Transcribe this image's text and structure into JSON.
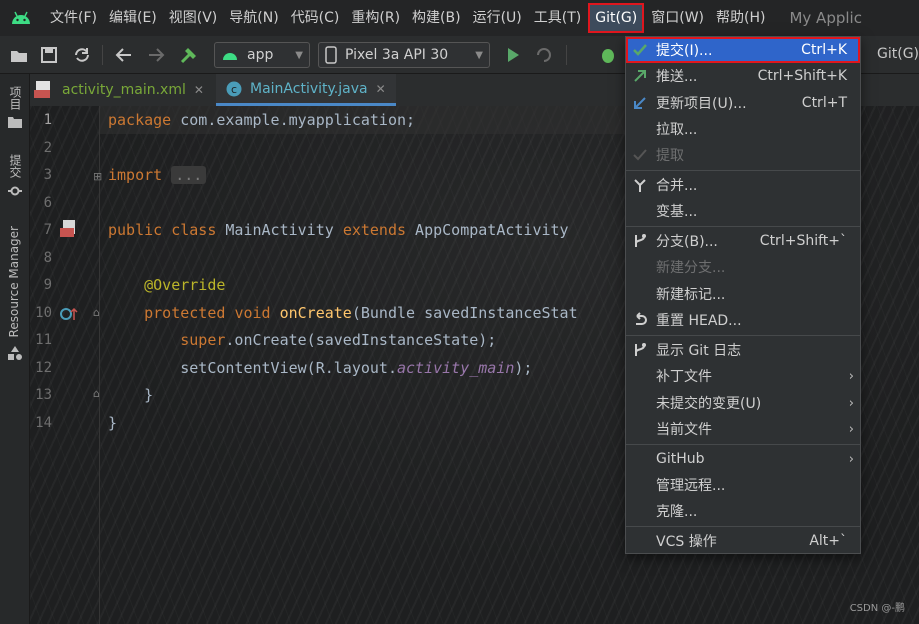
{
  "menubar": {
    "items": [
      {
        "label": "文件(F)"
      },
      {
        "label": "编辑(E)"
      },
      {
        "label": "视图(V)"
      },
      {
        "label": "导航(N)"
      },
      {
        "label": "代码(C)"
      },
      {
        "label": "重构(R)"
      },
      {
        "label": "构建(B)"
      },
      {
        "label": "运行(U)"
      },
      {
        "label": "工具(T)"
      },
      {
        "label": "Git(G)"
      },
      {
        "label": "窗口(W)"
      },
      {
        "label": "帮助(H)"
      }
    ],
    "window_title": "My Applic"
  },
  "toolbar": {
    "module": "app",
    "device": "Pixel 3a API 30",
    "git_label": "Git(G)"
  },
  "left_strip": {
    "project": "项目",
    "commit": "提交",
    "resource_manager": "Resource Manager"
  },
  "tabs": [
    {
      "label": "activity_main.xml"
    },
    {
      "label": "MainActivity.java"
    }
  ],
  "editor": {
    "line_numbers": [
      "1",
      "2",
      "3",
      "6",
      "7",
      "8",
      "9",
      "10",
      "11",
      "12",
      "13",
      "14"
    ],
    "lines": {
      "l1": {
        "kw": "package",
        "rest": " com.example.myapplication;"
      },
      "l3": {
        "kw": "import",
        "fold": "..."
      },
      "l7": {
        "kw1": "public",
        "kw2": "class",
        "name": " MainActivity ",
        "kw3": "extends",
        "rest": " AppCompatActivity"
      },
      "l9": {
        "ann": "@Override"
      },
      "l10": {
        "kw1": "protected",
        "kw2": "void",
        "fn": "onCreate",
        "rest": "(Bundle savedInstanceStat"
      },
      "l11": {
        "kw": "super",
        "rest": ".onCreate(savedInstanceState);"
      },
      "l12": {
        "pre": "setContentView(R.layout.",
        "it": "activity_main",
        "post": ");"
      },
      "l13": {
        "text": "}"
      },
      "l14": {
        "text": "}"
      }
    }
  },
  "git_menu": {
    "groups": [
      [
        {
          "label": "提交(I)...",
          "shortcut": "Ctrl+K",
          "icon": "check-icon",
          "selected": true
        },
        {
          "label": "推送...",
          "shortcut": "Ctrl+Shift+K",
          "icon": "push-arrow-icon"
        },
        {
          "label": "更新项目(U)...",
          "shortcut": "Ctrl+T",
          "icon": "update-arrow-icon"
        },
        {
          "label": "拉取...",
          "shortcut": "",
          "icon": ""
        },
        {
          "label": "提取",
          "shortcut": "",
          "icon": "fetch-icon",
          "disabled": true
        }
      ],
      [
        {
          "label": "合并...",
          "shortcut": "",
          "icon": "merge-icon"
        },
        {
          "label": "变基...",
          "shortcut": "",
          "icon": ""
        }
      ],
      [
        {
          "label": "分支(B)...",
          "shortcut": "Ctrl+Shift+`",
          "icon": "branch-icon"
        },
        {
          "label": "新建分支...",
          "shortcut": "",
          "icon": "",
          "disabled": true
        },
        {
          "label": "新建标记...",
          "shortcut": "",
          "icon": ""
        },
        {
          "label": "重置 HEAD...",
          "shortcut": "",
          "icon": "reset-icon"
        }
      ],
      [
        {
          "label": "显示 Git 日志",
          "shortcut": "",
          "icon": "log-icon"
        },
        {
          "label": "补丁文件",
          "shortcut": "",
          "icon": "",
          "submenu": true
        },
        {
          "label": "未提交的变更(U)",
          "shortcut": "",
          "icon": "",
          "submenu": true
        },
        {
          "label": "当前文件",
          "shortcut": "",
          "icon": "",
          "submenu": true
        }
      ],
      [
        {
          "label": "GitHub",
          "shortcut": "",
          "icon": "",
          "submenu": true
        },
        {
          "label": "管理远程...",
          "shortcut": "",
          "icon": ""
        },
        {
          "label": "克隆...",
          "shortcut": "",
          "icon": ""
        }
      ],
      [
        {
          "label": "VCS 操作",
          "shortcut": "Alt+`",
          "icon": ""
        }
      ]
    ]
  },
  "watermark": "CSDN @-鹏",
  "colors": {
    "accent_selected": "#2f65ca",
    "highlight_border": "#e0161e",
    "keyword": "#cc7832",
    "function": "#ffc66d",
    "annotation": "#bbb529"
  }
}
